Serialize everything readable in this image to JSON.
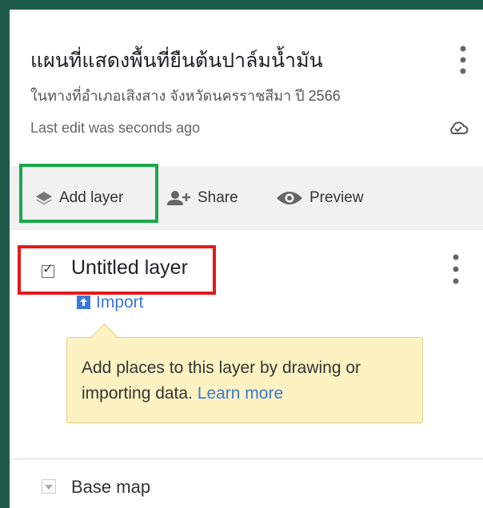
{
  "map": {
    "title": "แผนที่แสดงพื้นที่ยืนต้นปาล์มน้ำมัน",
    "subtitle": "ในทางที่อำเภอเสิงสาง จังหวัดนครราชสีมา ปี 2566",
    "last_edit": "Last edit was seconds ago"
  },
  "toolbar": {
    "add_layer": "Add layer",
    "share": "Share",
    "preview": "Preview"
  },
  "layer": {
    "name": "Untitled layer",
    "checked": true,
    "import_label": "Import",
    "hint": "Add places to this layer by drawing or importing data.",
    "learn_more": "Learn more"
  },
  "base_map": {
    "label": "Base map"
  },
  "colors": {
    "frame": "#1d5a4a",
    "highlight_green": "#1aa84a",
    "highlight_red": "#e01b1b",
    "link_blue": "#3b78d8",
    "tooltip_bg": "#fdf3c2"
  }
}
